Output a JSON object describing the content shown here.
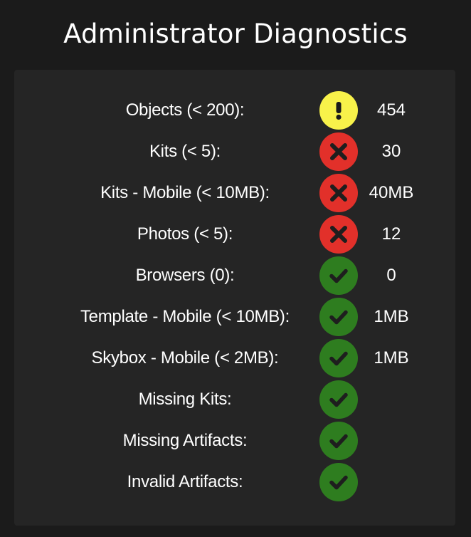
{
  "title": "Administrator Diagnostics",
  "rows": [
    {
      "label": "Objects (< 200):",
      "status": "warning",
      "icon": "exclamation-icon",
      "value": "454"
    },
    {
      "label": "Kits (< 5):",
      "status": "error",
      "icon": "x-icon",
      "value": "30"
    },
    {
      "label": "Kits - Mobile (< 10MB):",
      "status": "error",
      "icon": "x-icon",
      "value": "40MB"
    },
    {
      "label": "Photos (< 5):",
      "status": "error",
      "icon": "x-icon",
      "value": "12"
    },
    {
      "label": "Browsers (0):",
      "status": "ok",
      "icon": "checkmark-icon",
      "value": "0"
    },
    {
      "label": "Template - Mobile (< 10MB):",
      "status": "ok",
      "icon": "checkmark-icon",
      "value": "1MB"
    },
    {
      "label": "Skybox - Mobile (< 2MB):",
      "status": "ok",
      "icon": "checkmark-icon",
      "value": "1MB"
    },
    {
      "label": "Missing Kits:",
      "status": "ok",
      "icon": "checkmark-icon",
      "value": ""
    },
    {
      "label": "Missing Artifacts:",
      "status": "ok",
      "icon": "checkmark-icon",
      "value": ""
    },
    {
      "label": "Invalid Artifacts:",
      "status": "ok",
      "icon": "checkmark-icon",
      "value": ""
    }
  ],
  "colors": {
    "warning": "#f8f24a",
    "error": "#e2302a",
    "ok": "#2e7d1f",
    "background": "#1b1b1b",
    "panel": "#252525"
  }
}
